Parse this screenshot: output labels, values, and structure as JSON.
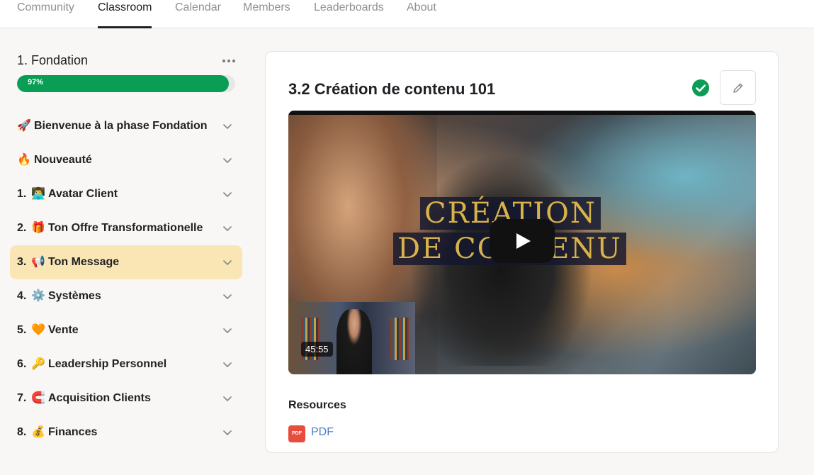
{
  "nav": {
    "tabs": [
      {
        "label": "Community"
      },
      {
        "label": "Classroom",
        "active": true
      },
      {
        "label": "Calendar"
      },
      {
        "label": "Members"
      },
      {
        "label": "Leaderboards"
      },
      {
        "label": "About"
      }
    ]
  },
  "sidebar": {
    "module_title": "1. Fondation",
    "more_icon": "more-horizontal-icon",
    "progress": {
      "label": "97%",
      "value": 0.97,
      "color": "#0a9e55"
    },
    "sections": [
      {
        "number": "",
        "emoji": "🚀",
        "label": "Bienvenue à la phase Fondation"
      },
      {
        "number": "",
        "emoji": "🔥",
        "label": "Nouveauté"
      },
      {
        "number": "1.",
        "emoji": "👨‍💻",
        "label": "Avatar Client"
      },
      {
        "number": "2.",
        "emoji": "🎁",
        "label": "Ton Offre Transformationelle"
      },
      {
        "number": "3.",
        "emoji": "📢",
        "label": "Ton Message",
        "active": true
      },
      {
        "number": "4.",
        "emoji": "⚙️",
        "label": "Systèmes"
      },
      {
        "number": "5.",
        "emoji": "🧡",
        "label": "Vente"
      },
      {
        "number": "6.",
        "emoji": "🔑",
        "label": "Leadership Personnel"
      },
      {
        "number": "7.",
        "emoji": "🧲",
        "label": "Acquisition Clients"
      },
      {
        "number": "8.",
        "emoji": "💰",
        "label": "Finances"
      }
    ],
    "active_color": "#fae5b4"
  },
  "lesson": {
    "title": "3.2 Création de contenu 101",
    "completed_icon": "check-circle-icon",
    "edit_icon": "pencil-icon",
    "video": {
      "thumbnail_text_line1": "CRÉATION",
      "thumbnail_text_line2": "DE CONTENU",
      "duration": "45:55",
      "play_icon": "play-icon"
    },
    "resources": {
      "title": "Resources",
      "items": [
        {
          "type": "PDF",
          "label": "PDF",
          "icon": "pdf-icon"
        }
      ]
    }
  },
  "colors": {
    "success": "#0a9e55",
    "link": "#4a7fc1",
    "pdf": "#e74c3c"
  }
}
